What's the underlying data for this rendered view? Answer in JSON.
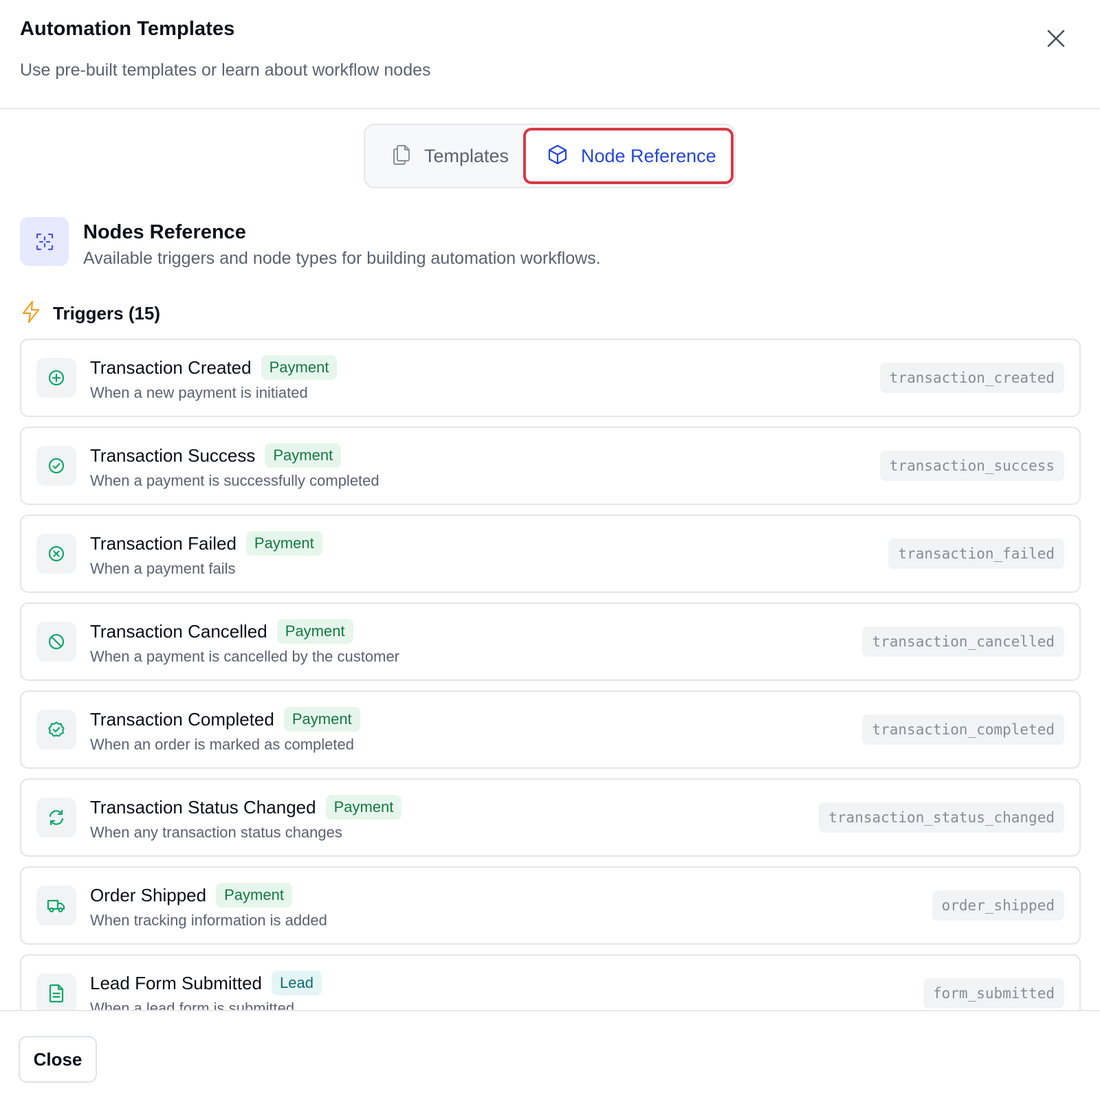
{
  "dialog": {
    "title": "Automation Templates",
    "subtitle": "Use pre-built templates or learn about workflow nodes"
  },
  "tabs": [
    {
      "label": "Templates",
      "icon": "copy-icon",
      "active": false
    },
    {
      "label": "Node Reference",
      "icon": "cube-icon",
      "active": true
    }
  ],
  "section": {
    "icon": "focus-icon",
    "title": "Nodes Reference",
    "description": "Available triggers and node types for building automation workflows."
  },
  "triggers": {
    "icon": "lightning-icon",
    "label": "Triggers (15)",
    "items": [
      {
        "name": "Transaction Created",
        "badge": "Payment",
        "badge_type": "payment",
        "description": "When a new payment is initiated",
        "code": "transaction_created",
        "icon": "plus-circle-icon"
      },
      {
        "name": "Transaction Success",
        "badge": "Payment",
        "badge_type": "payment",
        "description": "When a payment is successfully completed",
        "code": "transaction_success",
        "icon": "check-circle-icon"
      },
      {
        "name": "Transaction Failed",
        "badge": "Payment",
        "badge_type": "payment",
        "description": "When a payment fails",
        "code": "transaction_failed",
        "icon": "x-circle-icon"
      },
      {
        "name": "Transaction Cancelled",
        "badge": "Payment",
        "badge_type": "payment",
        "description": "When a payment is cancelled by the customer",
        "code": "transaction_cancelled",
        "icon": "ban-icon"
      },
      {
        "name": "Transaction Completed",
        "badge": "Payment",
        "badge_type": "payment",
        "description": "When an order is marked as completed",
        "code": "transaction_completed",
        "icon": "badge-check-icon"
      },
      {
        "name": "Transaction Status Changed",
        "badge": "Payment",
        "badge_type": "payment",
        "description": "When any transaction status changes",
        "code": "transaction_status_changed",
        "icon": "refresh-icon"
      },
      {
        "name": "Order Shipped",
        "badge": "Payment",
        "badge_type": "payment",
        "description": "When tracking information is added",
        "code": "order_shipped",
        "icon": "truck-icon"
      },
      {
        "name": "Lead Form Submitted",
        "badge": "Lead",
        "badge_type": "lead",
        "description": "When a lead form is submitted",
        "code": "form_submitted",
        "icon": "file-text-icon"
      }
    ]
  },
  "footer": {
    "close_label": "Close"
  },
  "colors": {
    "accent": "#2446d9",
    "highlight_border": "#d63a46",
    "trigger_icon": "#10a86a",
    "lightning": "#f0a020",
    "payment_badge_text": "#127a43",
    "lead_badge_text": "#0f6a73"
  }
}
